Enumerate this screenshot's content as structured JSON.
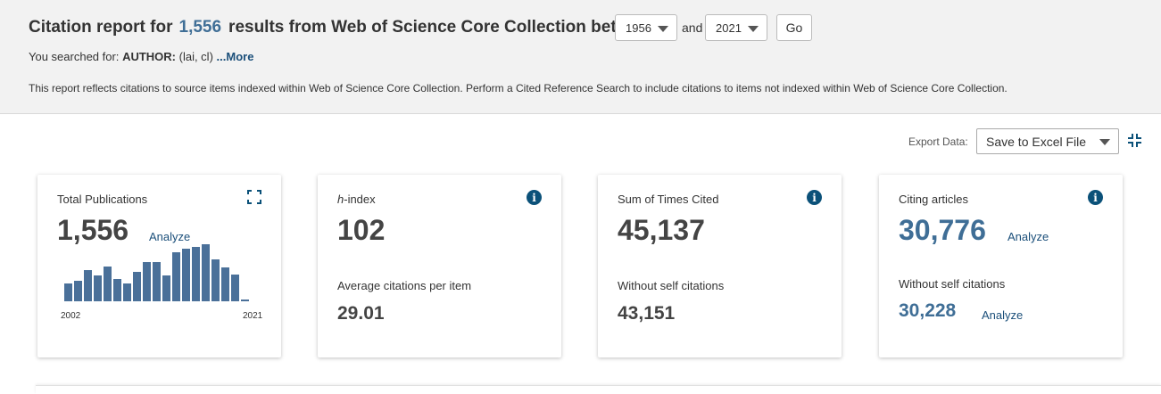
{
  "header": {
    "title_prefix": "Citation report for",
    "result_count": "1,556",
    "title_suffix": "results from Web of Science Core Collection between",
    "year_from": "1956",
    "and_label": "and",
    "year_to": "2021",
    "go_label": "Go",
    "searched_prefix": "You searched for:",
    "searched_field": "AUTHOR:",
    "searched_value": "(lai, cl)",
    "more_label": "...More",
    "report_note": "This report reflects citations to source items indexed within Web of Science Core Collection. Perform a Cited Reference Search to include citations to items not indexed within Web of Science Core Collection."
  },
  "export": {
    "label": "Export Data:",
    "selected": "Save to Excel File"
  },
  "cards": {
    "publications": {
      "label": "Total Publications",
      "value": "1,556",
      "analyze": "Analyze",
      "year_start": "2002",
      "year_end": "2021"
    },
    "hindex": {
      "label_italic": "h",
      "label_rest": "-index",
      "value": "102",
      "sub_label": "Average citations per item",
      "sub_value": "29.01"
    },
    "times_cited": {
      "label": "Sum of Times Cited",
      "value": "45,137",
      "sub_label": "Without self citations",
      "sub_value": "43,151"
    },
    "citing": {
      "label": "Citing articles",
      "value": "30,776",
      "analyze": "Analyze",
      "sub_label": "Without self citations",
      "sub_value": "30,228",
      "sub_analyze": "Analyze"
    }
  },
  "chart_data": {
    "type": "bar",
    "categories": [
      "2002",
      "2003",
      "2004",
      "2005",
      "2006",
      "2007",
      "2008",
      "2009",
      "2010",
      "2011",
      "2012",
      "2013",
      "2014",
      "2015",
      "2016",
      "2017",
      "2018",
      "2019",
      "2020",
      "2021"
    ],
    "values": [
      33,
      39,
      58,
      48,
      65,
      42,
      34,
      55,
      73,
      73,
      48,
      92,
      98,
      102,
      107,
      78,
      64,
      50,
      4,
      0
    ],
    "ylim": [
      0,
      110
    ],
    "color": "#4a7099"
  },
  "colors": {
    "accent": "#3f6e96",
    "link": "#1b4f7a",
    "info_icon": "#0b5179",
    "header_bg": "#f2f2f2"
  }
}
